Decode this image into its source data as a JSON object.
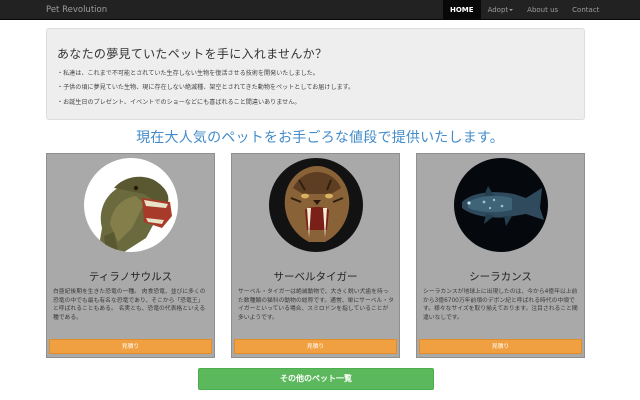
{
  "navbar": {
    "brand": "Pet Revolution",
    "items": [
      {
        "label": "HOME",
        "active": true
      },
      {
        "label": "Adopt",
        "dropdown": true
      },
      {
        "label": "About us"
      },
      {
        "label": "Contact"
      }
    ]
  },
  "jumbotron": {
    "title": "あなたの夢見ていたペットを手に入れませんか？",
    "lines": [
      "・私達は、これまで不可能とされていた生存しない生物を復活させる技術を開発いたしました。",
      "・子供の頃に夢見ていた生物、現に存在しない絶滅種、架空とされてきた動物をペットとしてお届けします。",
      "・お誕生日のプレゼント、イベントでのショーなどにも喜ばれること間違いありません。"
    ]
  },
  "headline": "現在大人気のペットをお手ごろな値段で提供いたします。",
  "cards": [
    {
      "title": "ティラノサウルス",
      "description": "白亜紀後期を生きた恐竜の一種。 肉食恐竜、並びに多くの恐竜の中でも最も有名な恐竜であり、そこから「恐竜王」と呼ばれることもある。 名実とも、恐竜の代表格といえる種である。",
      "button": "見積り",
      "image": "t-rex-head",
      "image_bg": "#ffffff"
    },
    {
      "title": "サーベルタイガー",
      "description": "サーベル・タイガーは絶滅動物で、大きく鋭い犬歯を持った数種類の猫科の動物の総称です。通常、単にサーベル・タイガーといっている場合、スミロドンを指していることが多いようです。",
      "button": "見積り",
      "image": "saber-tooth-tiger",
      "image_bg": "#121212"
    },
    {
      "title": "シーラカンス",
      "description": "シーラカンスが地球上に出現したのは、今から4億年以上前から3億6700万年前頃のデボン紀と呼ばれる時代の中頃です。様々なサイズを取り揃えております。注目されること間違いなしです。",
      "button": "見積り",
      "image": "coelacanth",
      "image_bg": "#05080c"
    }
  ],
  "more_button": "その他のペット一覧",
  "colors": {
    "navbar": "#222222",
    "headline": "#428bca",
    "card": "#a9a9a9",
    "card_button": "#f0a040",
    "more_button": "#5cb85c"
  }
}
